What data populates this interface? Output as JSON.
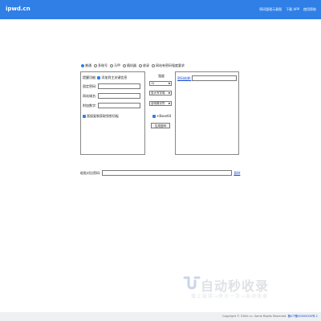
{
  "header": {
    "logo": "ipwd.cn",
    "nav": [
      "密码管理示意图",
      "下载 APP",
      "使用帮助"
    ]
  },
  "modes": {
    "items": [
      {
        "label": "普通",
        "selected": true
      },
      {
        "label": "多账号",
        "selected": false
      },
      {
        "label": "马甲",
        "selected": false
      },
      {
        "label": "随机器",
        "selected": false
      },
      {
        "label": "收录",
        "selected": false
      },
      {
        "label": "网站有密码强度要求",
        "selected": false
      }
    ]
  },
  "left_panel": {
    "first_label": "提醒功能:",
    "first_check": "添加到主关键信息",
    "fields": [
      {
        "label": "固定密码:",
        "value": ""
      },
      {
        "label": "网站域名:",
        "value": ""
      },
      {
        "label": "附加数字:",
        "value": ""
      }
    ],
    "bottom_check": "直接复制获取到剪切板"
  },
  "middle": {
    "label": "强度",
    "selects": [
      "12",
      "含大写字母",
      "含特殊字符"
    ],
    "base64_label": "+Base64",
    "generate_label": "生成密码"
  },
  "right_panel": {
    "link": "密码结果:",
    "value": ""
  },
  "verify": {
    "label": "粘贴对比密码:",
    "value": "",
    "link": "复制"
  },
  "brand": {
    "name": "自动秒收录",
    "tagline": "做上链接→来访一次→自动收录"
  },
  "footer": {
    "copyright": "Copyright © 516cl.cn. Some Rights Reserved.",
    "icp": "备ICP备00000000号-1"
  },
  "colors": {
    "accent": "#2f7fe6",
    "link": "#1a4bd6",
    "footer_bg": "#eef0f2"
  }
}
